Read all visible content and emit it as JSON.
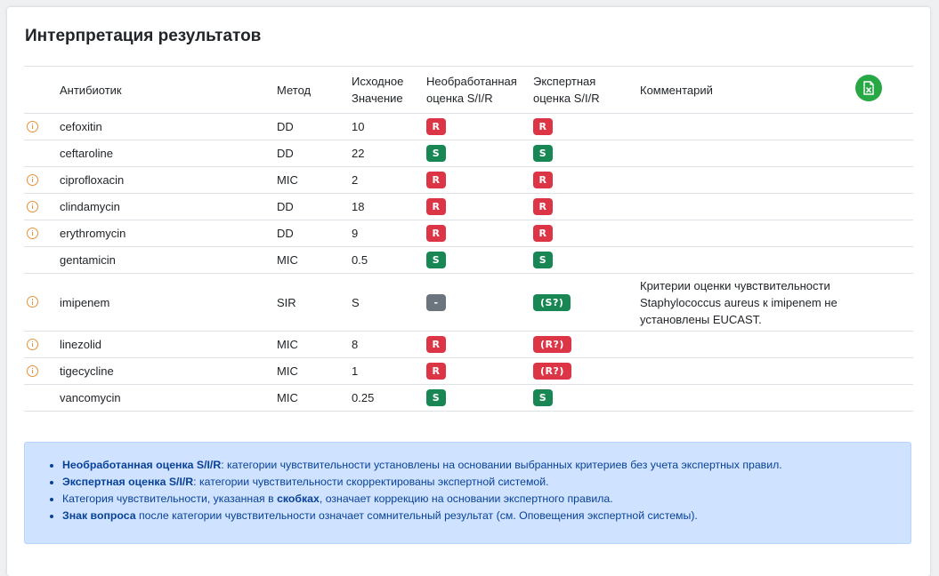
{
  "title": "Интерпретация результатов",
  "table": {
    "headers": {
      "antibiotic": "Антибиотик",
      "method": "Метод",
      "raw_line1": "Исходное",
      "raw_line2": "Значение",
      "unprocessed_line1": "Необработанная",
      "unprocessed_line2": "оценка S/I/R",
      "expert_line1": "Экспертная",
      "expert_line2": "оценка S/I/R",
      "comment": "Комментарий"
    },
    "export_button": "excel-export-icon",
    "rows": [
      {
        "alert": true,
        "antibiotic": "cefoxitin",
        "method": "DD",
        "value": "10",
        "raw": "R",
        "raw_type": "R",
        "expert": "R",
        "expert_type": "R",
        "comment": ""
      },
      {
        "alert": false,
        "antibiotic": "ceftaroline",
        "method": "DD",
        "value": "22",
        "raw": "S",
        "raw_type": "S",
        "expert": "S",
        "expert_type": "S",
        "comment": ""
      },
      {
        "alert": true,
        "antibiotic": "ciprofloxacin",
        "method": "MIC",
        "value": "2",
        "raw": "R",
        "raw_type": "R",
        "expert": "R",
        "expert_type": "R",
        "comment": ""
      },
      {
        "alert": true,
        "antibiotic": "clindamycin",
        "method": "DD",
        "value": "18",
        "raw": "R",
        "raw_type": "R",
        "expert": "R",
        "expert_type": "R",
        "comment": ""
      },
      {
        "alert": true,
        "antibiotic": "erythromycin",
        "method": "DD",
        "value": "9",
        "raw": "R",
        "raw_type": "R",
        "expert": "R",
        "expert_type": "R",
        "comment": ""
      },
      {
        "alert": false,
        "antibiotic": "gentamicin",
        "method": "MIC",
        "value": "0.5",
        "raw": "S",
        "raw_type": "S",
        "expert": "S",
        "expert_type": "S",
        "comment": ""
      },
      {
        "alert": true,
        "antibiotic": "imipenem",
        "method": "SIR",
        "value": "S",
        "raw": "-",
        "raw_type": "N",
        "expert": "(S?)",
        "expert_type": "S",
        "comment": "Критерии оценки чувствительности Staphylococcus aureus к imipenem не установлены EUCAST."
      },
      {
        "alert": true,
        "antibiotic": "linezolid",
        "method": "MIC",
        "value": "8",
        "raw": "R",
        "raw_type": "R",
        "expert": "(R?)",
        "expert_type": "R",
        "comment": ""
      },
      {
        "alert": true,
        "antibiotic": "tigecycline",
        "method": "MIC",
        "value": "1",
        "raw": "R",
        "raw_type": "R",
        "expert": "(R?)",
        "expert_type": "R",
        "comment": ""
      },
      {
        "alert": false,
        "antibiotic": "vancomycin",
        "method": "MIC",
        "value": "0.25",
        "raw": "S",
        "raw_type": "S",
        "expert": "S",
        "expert_type": "S",
        "comment": ""
      }
    ]
  },
  "colors": {
    "resistant": "#dc3545",
    "susceptible": "#198754",
    "neutral": "#6c757d",
    "alert": "#e8903a",
    "export": "#28a745",
    "note_bg": "#cfe2ff"
  },
  "legend": {
    "items": [
      {
        "bold": "Необработанная оценка S/I/R",
        "text": ": категории чувствительности установлены на основании выбранных критериев без учета экспертных правил."
      },
      {
        "bold": "Экспертная оценка S/I/R",
        "text": ": категории чувствительности скорректированы экспертной системой."
      },
      {
        "pre": "Категория чувствительности, указанная в ",
        "bold": "скобках",
        "text": ", означает коррекцию на основании экспертного правила."
      },
      {
        "bold": "Знак вопроса",
        "text": " после категории чувствительности означает сомнительный результат (см. Оповещения экспертной системы)."
      }
    ]
  }
}
